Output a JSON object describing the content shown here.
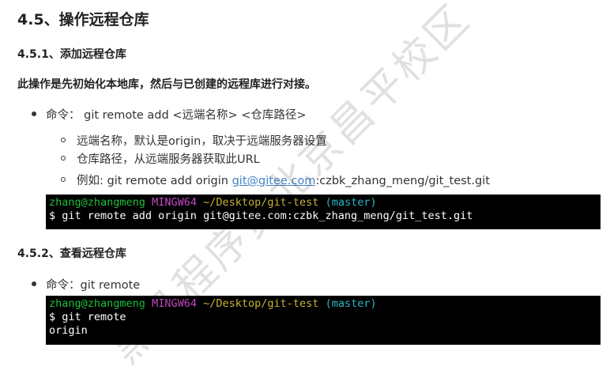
{
  "section_title": "4.5、操作远程仓库",
  "sub1": {
    "title": "4.5.1、添加远程仓库",
    "intro": "此操作是先初始化本地库，然后与已创建的远程库进行对接。",
    "command_line": "命令： git remote add <远端名称> <仓库路径>",
    "sub_items": [
      "远端名称，默认是origin，取决于远端服务器设置",
      "仓库路径，从远端服务器获取此URL"
    ],
    "example_prefix": "例如: git remote add origin ",
    "example_link": "git@gitee.com",
    "example_suffix": ":czbk_zhang_meng/git_test.git",
    "terminal": {
      "user": "zhang@zhangmeng",
      "system": "MINGW64",
      "path": "~/Desktop/git-test",
      "branch": "(master)",
      "command": "$ git remote add origin git@gitee.com:czbk_zhang_meng/git_test.git"
    }
  },
  "sub2": {
    "title": "4.5.2、查看远程仓库",
    "command_line": "命令：git remote",
    "terminal": {
      "user": "zhang@zhangmeng",
      "system": "MINGW64",
      "path": "~/Desktop/git-test",
      "branch": "(master)",
      "command": "$ git remote",
      "output": "origin"
    }
  },
  "watermark": "黑马程序员北京昌平校区"
}
